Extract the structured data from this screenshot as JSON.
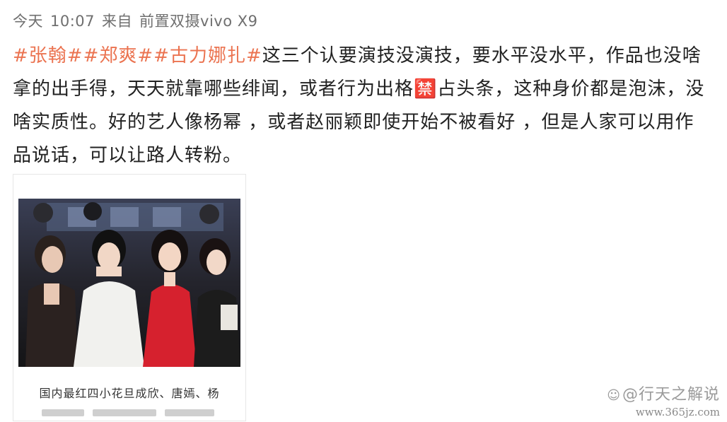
{
  "post": {
    "time_label": "今天",
    "time": "10:07",
    "source_prefix": "来自",
    "device": "前置双摄vivo X9",
    "topics": [
      "#张翰#",
      "#郑爽#",
      "#古力娜扎#"
    ],
    "body": "这三个认要演技没演技，要水平没水平，作品也没啥拿的出手得，天天就靠哪些绯闻，或者行为出格🈲占头条，这种身价都是泡沫，没啥实质性。好的艺人像杨幂 ，或者赵丽颖即使开始不被看好 ，但是人家可以用作品说话，可以让路人转粉。"
  },
  "image": {
    "caption": "国内最红四小花旦成欣、唐嫣、杨"
  },
  "watermark": {
    "icon": "weibo-icon",
    "name": "@行天之解说",
    "url": "www.365jz.com"
  }
}
